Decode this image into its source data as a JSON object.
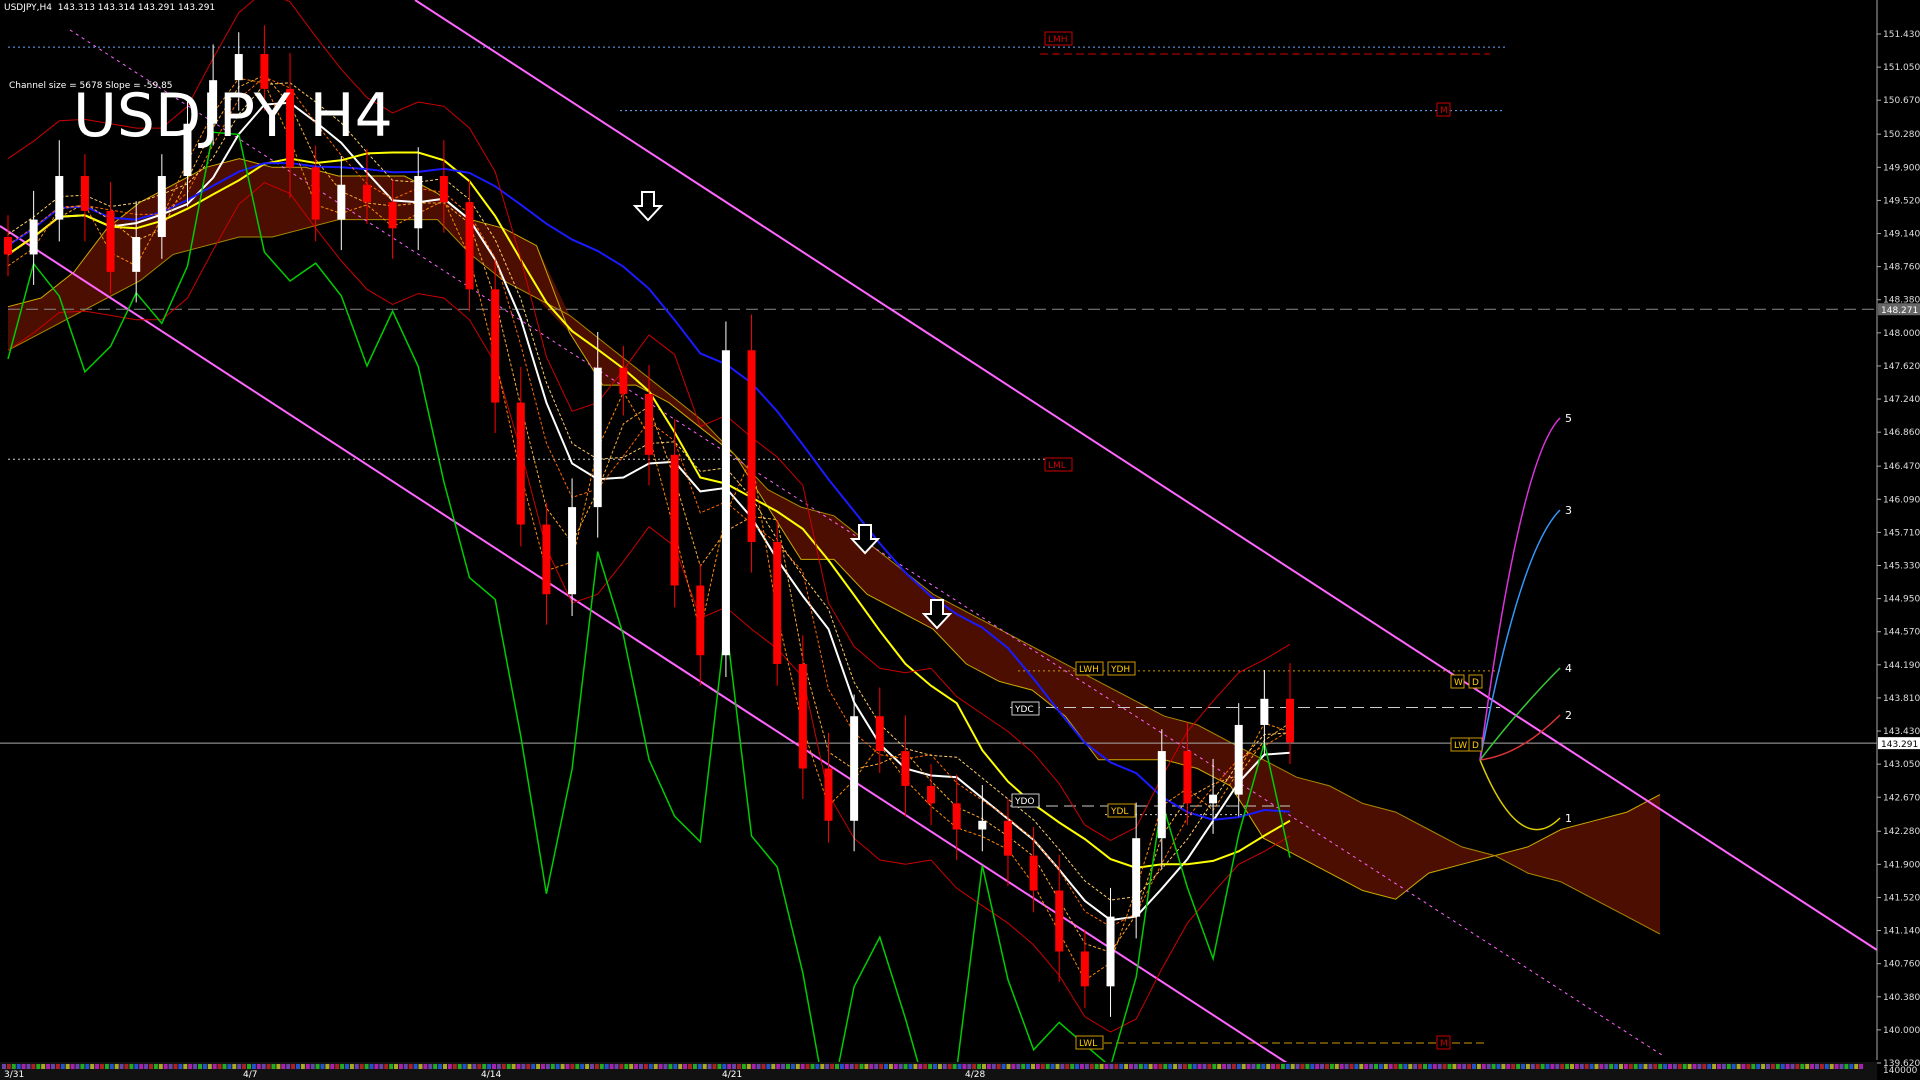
{
  "header": {
    "symbol": "USDJPY,H4",
    "ohlc": "143.313 143.314 143.291 143.291"
  },
  "title": "USDJPY H4",
  "channel_info": "Channel size = 5678 Slope = -59.85",
  "current_price": "143.291",
  "dashed_level_label": "148.271",
  "volume_scale_label": "140000",
  "colors": {
    "background": "#000000",
    "bull_candle": "#ffffff",
    "bear_candle": "#ff0000",
    "channel": "#ff66ff",
    "ma_white": "#ffffff",
    "ma_yellow": "#ffff00",
    "ma_blue": "#1a1aff",
    "oscillator": "#00cc00",
    "envelope_red": "#cc0000",
    "cloud_fill": "#8b1a00",
    "cloud_edge": "#ccaa00"
  },
  "level_labels": {
    "lmh": "LMH",
    "m_top": "M",
    "lml": "LML",
    "lwh": "LWH",
    "ydh": "YDH",
    "ydc": "YDC",
    "ydo": "YDO",
    "ydl": "YDL",
    "lwl": "LWL",
    "m_bottom": "M",
    "wh": "W",
    "d_top": "D",
    "lw": "LW",
    "d_bottom": "D"
  },
  "projection_labels": [
    "5",
    "3",
    "4",
    "2",
    "1"
  ],
  "chart_data": {
    "type": "candlestick",
    "symbol": "USDJPY",
    "timeframe": "H4",
    "y_ticks": [
      "151.430",
      "151.050",
      "150.670",
      "150.280",
      "149.900",
      "149.520",
      "149.140",
      "148.760",
      "148.380",
      "148.000",
      "147.620",
      "147.240",
      "146.860",
      "146.470",
      "146.090",
      "145.710",
      "145.330",
      "144.950",
      "144.570",
      "144.190",
      "143.810",
      "143.430",
      "143.050",
      "142.670",
      "142.280",
      "141.900",
      "141.520",
      "141.140",
      "140.760",
      "140.380",
      "140.000",
      "139.620"
    ],
    "ylim": [
      139.5,
      151.7
    ],
    "x_ticks": [
      "3/31",
      "4/7",
      "4/14",
      "4/21",
      "4/28"
    ],
    "grid": false,
    "levels": {
      "LMH": 151.28,
      "M_upper": 150.55,
      "dashed_ref": 148.271,
      "LML": 146.55,
      "LWH": 144.12,
      "YDC": 143.7,
      "current": 143.291,
      "YDO": 142.57,
      "YDL": 142.47,
      "LWL": 139.85
    },
    "candles_close_path": [
      148.9,
      149.3,
      149.8,
      149.4,
      148.7,
      149.1,
      149.8,
      150.4,
      150.9,
      151.2,
      150.8,
      149.9,
      149.3,
      149.7,
      149.5,
      149.2,
      149.8,
      149.5,
      148.5,
      147.2,
      145.8,
      145.0,
      146.0,
      147.6,
      147.3,
      146.6,
      145.1,
      144.3,
      147.8,
      145.6,
      144.2,
      143.0,
      142.4,
      143.6,
      143.2,
      142.8,
      142.6,
      142.3,
      142.4,
      142.0,
      141.6,
      140.9,
      140.5,
      141.3,
      142.2,
      143.2,
      142.6,
      142.7,
      143.5,
      143.8,
      143.3
    ],
    "projections": [
      {
        "name": "1",
        "value": 142.3
      },
      {
        "name": "2",
        "value": 143.65
      },
      {
        "name": "3",
        "value": 145.9
      },
      {
        "name": "4",
        "value": 144.15
      },
      {
        "name": "5",
        "value": 146.95
      }
    ]
  }
}
